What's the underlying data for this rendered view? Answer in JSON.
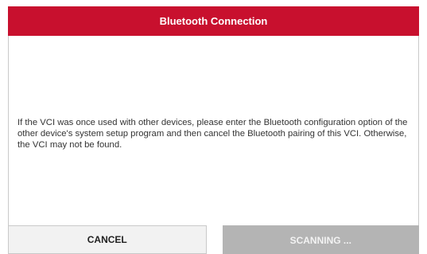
{
  "dialog": {
    "title": "Bluetooth Connection",
    "message": "If the VCI was once used with other devices, please enter the Bluetooth configuration option of the other device's system setup program and then cancel the Bluetooth pairing of this VCI. Otherwise, the VCI may not be found.",
    "cancel_label": "CANCEL",
    "scanning_label": "SCANNING ..."
  },
  "colors": {
    "title_bar": "#c8102e",
    "scanning_button_disabled": "#b4b4b4"
  }
}
